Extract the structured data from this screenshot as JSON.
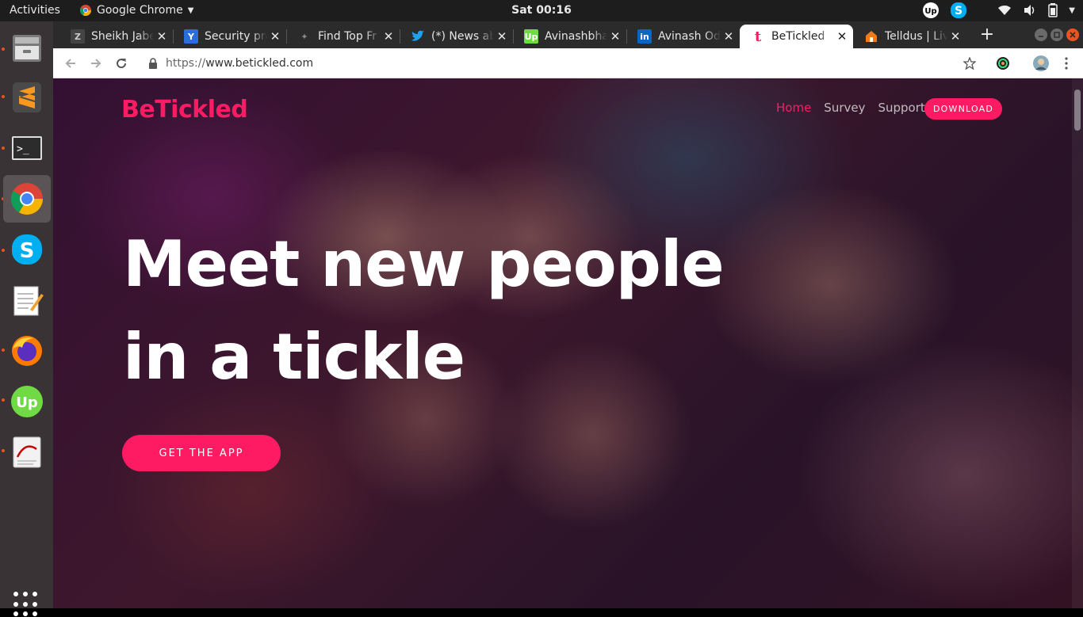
{
  "topbar": {
    "activities": "Activities",
    "app_name": "Google Chrome",
    "clock": "Sat 00:16"
  },
  "browser": {
    "tabs": [
      {
        "title": "Sheikh Jabe",
        "favicon": "z-square-icon"
      },
      {
        "title": "Security pro",
        "favicon": "shield-y-icon"
      },
      {
        "title": "Find Top Fr",
        "favicon": "ninja-icon"
      },
      {
        "title": "(*) News ab",
        "favicon": "twitter-icon"
      },
      {
        "title": "Avinashbha",
        "favicon": "upwork-icon"
      },
      {
        "title": "Avinash Od",
        "favicon": "linkedin-icon"
      },
      {
        "title": "BeTickled",
        "favicon": "betickled-icon",
        "active": true
      },
      {
        "title": "Telldus | Liv",
        "favicon": "telldus-icon"
      }
    ],
    "url_protocol": "https://",
    "url_host": "www.betickled.com"
  },
  "site": {
    "brand": "BeTickled",
    "nav": {
      "home": "Home",
      "survey": "Survey",
      "support": "Support",
      "download": "DOWNLOAD"
    },
    "hero": {
      "line1": "Meet new people",
      "line2": "in a tickle"
    },
    "cta": "GET THE APP"
  },
  "colors": {
    "accent": "#ff1b64",
    "ubuntu_orange": "#e95420"
  }
}
